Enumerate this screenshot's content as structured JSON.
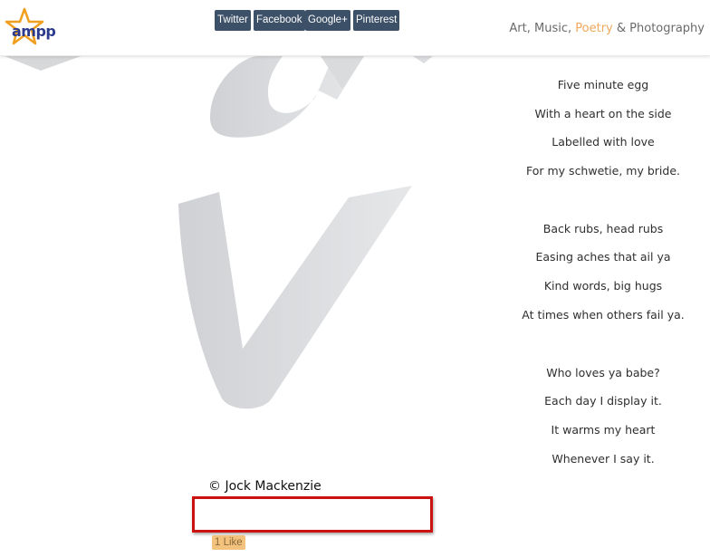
{
  "header": {
    "logo_text": "ampp",
    "nav": {
      "art": "Art,",
      "music": "Music,",
      "poetry": "Poetry",
      "amp_photography": "& Photography"
    }
  },
  "poem": {
    "stanza1": [
      "Five minute egg",
      "With a heart on the side",
      "Labelled with love",
      "For my schwetie, my bride."
    ],
    "stanza2": [
      "Back rubs, head rubs",
      "Easing aches that ail ya",
      "Kind words, big hugs",
      "At times when others fail ya."
    ],
    "stanza3": [
      "Who loves ya babe?",
      "Each day I display it.",
      "It warms my heart",
      "Whenever I say it."
    ]
  },
  "copyright": "© Jock Mackenzie",
  "share": {
    "twitter": "Twitter",
    "facebook": "Facebook",
    "googleplus": "Google+",
    "pinterest": "Pinterest"
  },
  "like": "1 Like",
  "colors": {
    "accent": "#f0a85a",
    "button": "#3c5068",
    "highlight_border": "#cc1111",
    "like_button": "#f3c27d"
  },
  "icons": {
    "logo": "star-logo-icon"
  }
}
